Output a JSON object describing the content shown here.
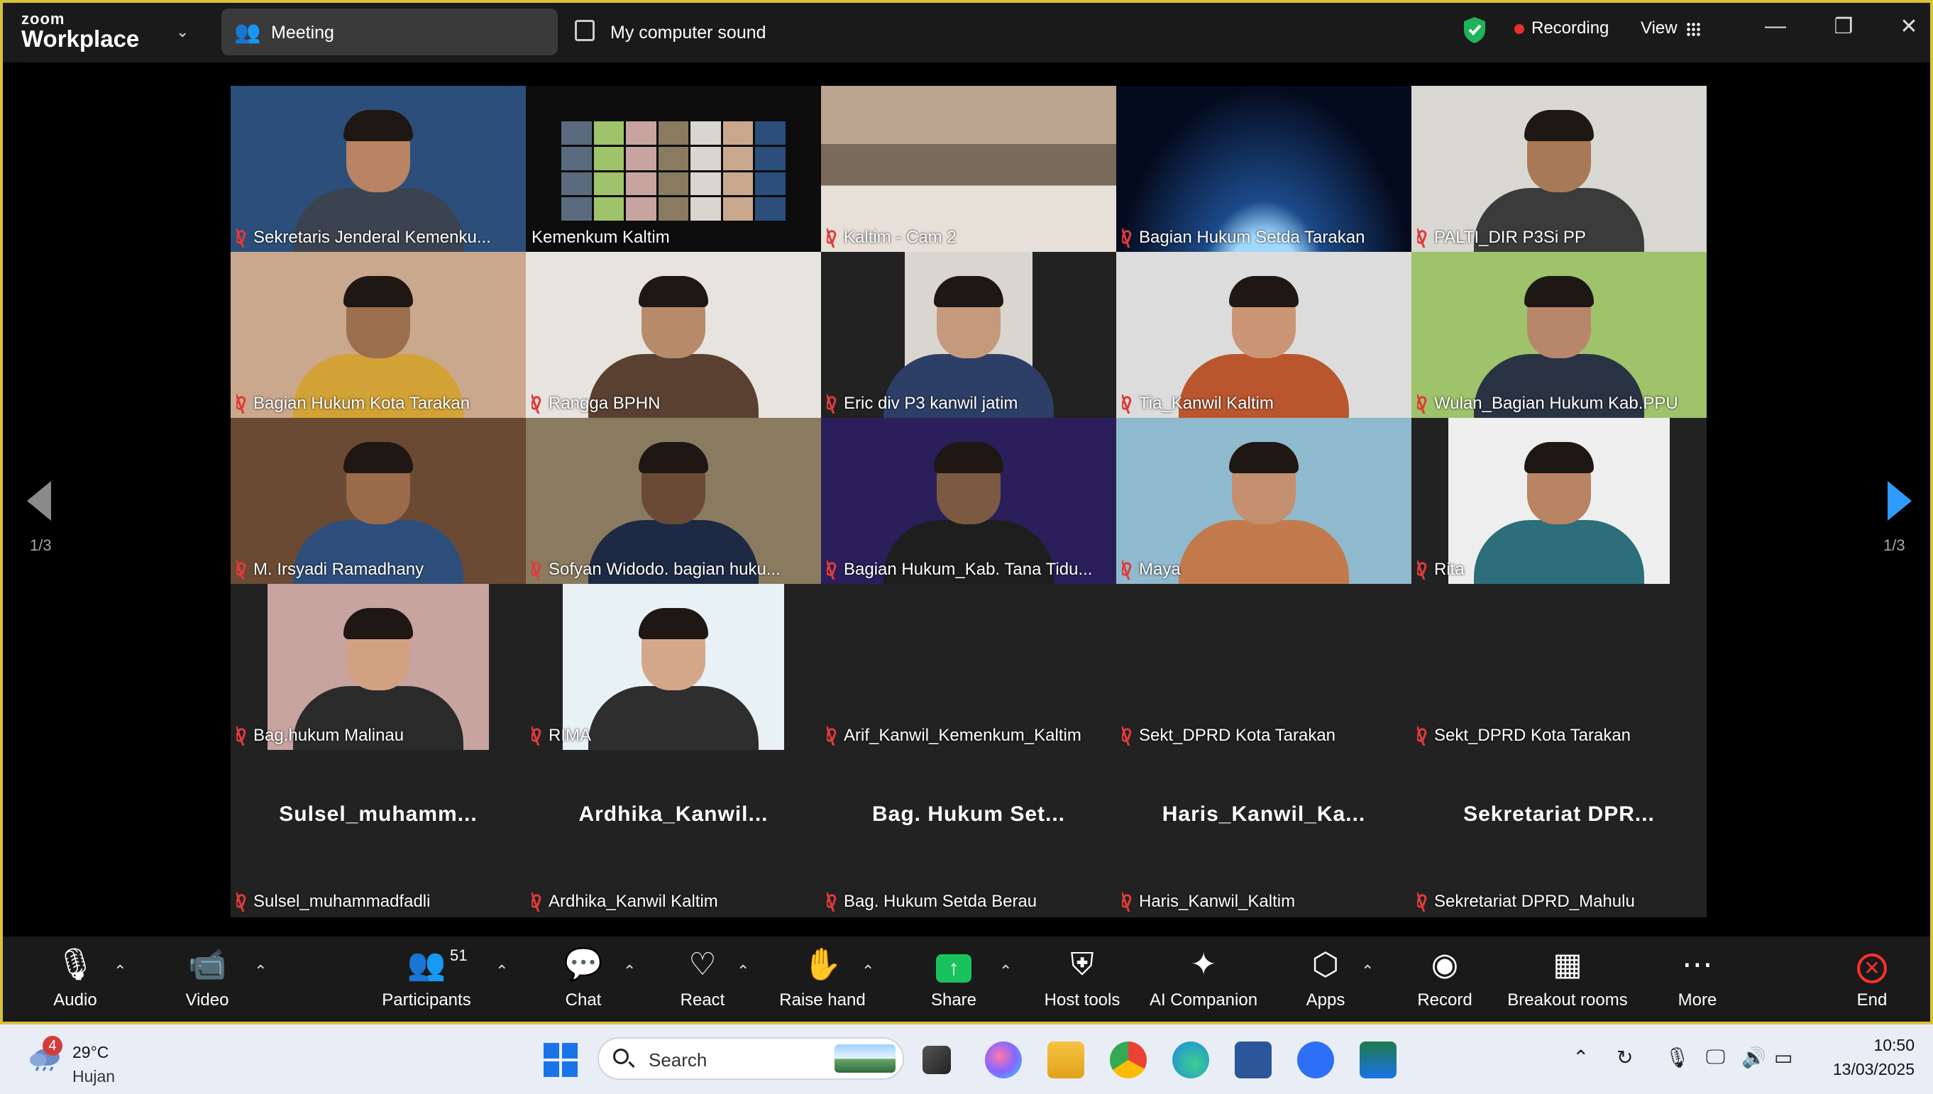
{
  "app": {
    "brand_small": "zoom",
    "brand_large": "Workplace"
  },
  "header": {
    "meeting_tab": "Meeting",
    "sound_tab": "My computer sound",
    "recording": "Recording",
    "view": "View"
  },
  "pager": {
    "left": "1/3",
    "right": "1/3"
  },
  "tiles": [
    {
      "name": "Sekretaris Jenderal Kemenku...",
      "bg": "#2b4f7a",
      "skin": "#b88463",
      "shirt": "#3c4350"
    },
    {
      "name": "Kemenkum Kaltim",
      "bg": "#101010"
    },
    {
      "name": "Kaltim - Cam 2",
      "bg": "#8c7a6a"
    },
    {
      "name": "Bagian Hukum Setda Tarakan",
      "bg": "#0a1a3a"
    },
    {
      "name": "PALTI_DIR P3Si PP",
      "bg": "#d9d7d1",
      "skin": "#a77956",
      "shirt": "#3b3b3b"
    },
    {
      "name": "Bagian Hukum Kota Tarakan",
      "bg": "#c9a88d",
      "skin": "#9b6f4d",
      "shirt": "#d3a236"
    },
    {
      "name": "Rangga BPHN",
      "bg": "#e7e3df",
      "skin": "#b78b6a",
      "shirt": "#5a4030"
    },
    {
      "name": "Eric div P3 kanwil jatim",
      "bg": "#d9d6cf",
      "skin": "#c59a7c",
      "shirt": "#2d3f66"
    },
    {
      "name": "Tia_Kanwil Kaltim",
      "bg": "#dcdcdc",
      "skin": "#c99574",
      "shirt": "#b9562e"
    },
    {
      "name": "Wulan_Bagian Hukum Kab.PPU",
      "bg": "#9ec36a",
      "skin": "#b8866a",
      "shirt": "#2a3344"
    },
    {
      "name": "M. Irsyadi Ramadhany",
      "bg": "#6b4a33",
      "skin": "#9a6a4a",
      "shirt": "#2e4f7c"
    },
    {
      "name": "Sofyan Widodo. bagian huku...",
      "bg": "#8a7a60",
      "skin": "#6b4a35",
      "shirt": "#1e2a44"
    },
    {
      "name": "Bagian Hukum_Kab. Tana Tidu...",
      "bg": "#2a1f5a",
      "skin": "#7c5a42",
      "shirt": "#1e1e1e"
    },
    {
      "name": "Maya",
      "bg": "#8fb9cc",
      "skin": "#c38f6f",
      "shirt": "#c27a4d"
    },
    {
      "name": "Rita",
      "bg": "#eeeeee",
      "skin": "#b88463",
      "shirt": "#2c6e7a"
    },
    {
      "name": "Bag.hukum Malinau",
      "bg": "#c7a4a0",
      "skin": "#d2a182",
      "shirt": "#2b2b2b"
    },
    {
      "name": "RIMA",
      "bg": "#e8f1f4",
      "skin": "#d3a88a",
      "shirt": "#2e2e2e"
    },
    {
      "name": "Arif_Kanwil_Kemenkum_Kaltim"
    },
    {
      "name": "Sekt_DPRD Kota Tarakan"
    },
    {
      "name": "Sekt_DPRD Kota Tarakan"
    },
    {
      "name": "Sulsel_muhammadfadli",
      "display": "Sulsel_muhamm..."
    },
    {
      "name": "Ardhika_Kanwil Kaltim",
      "display": "Ardhika_Kanwil..."
    },
    {
      "name": "Bag. Hukum Setda Berau",
      "display": "Bag. Hukum Set..."
    },
    {
      "name": "Haris_Kanwil_Kaltim",
      "display": "Haris_Kanwil_Ka..."
    },
    {
      "name": "Sekretariat DPRD_Mahulu",
      "display": "Sekretariat  DPR..."
    }
  ],
  "toolbar": {
    "audio": "Audio",
    "video": "Video",
    "participants": "Participants",
    "participants_count": "51",
    "chat": "Chat",
    "react": "React",
    "raise_hand": "Raise hand",
    "share": "Share",
    "host_tools": "Host tools",
    "ai_companion": "AI Companion",
    "apps": "Apps",
    "record": "Record",
    "breakout_rooms": "Breakout rooms",
    "more": "More",
    "end": "End"
  },
  "taskbar": {
    "notifications": "4",
    "temperature": "29°C",
    "condition": "Hujan",
    "search_placeholder": "Search",
    "time": "10:50",
    "date": "13/03/2025"
  },
  "colors": {
    "accent_green": "#2fd17a",
    "muted_red": "#e03b3b",
    "share_green": "#19c25d",
    "end_red": "#ff3030",
    "next_blue": "#2f9bff"
  }
}
